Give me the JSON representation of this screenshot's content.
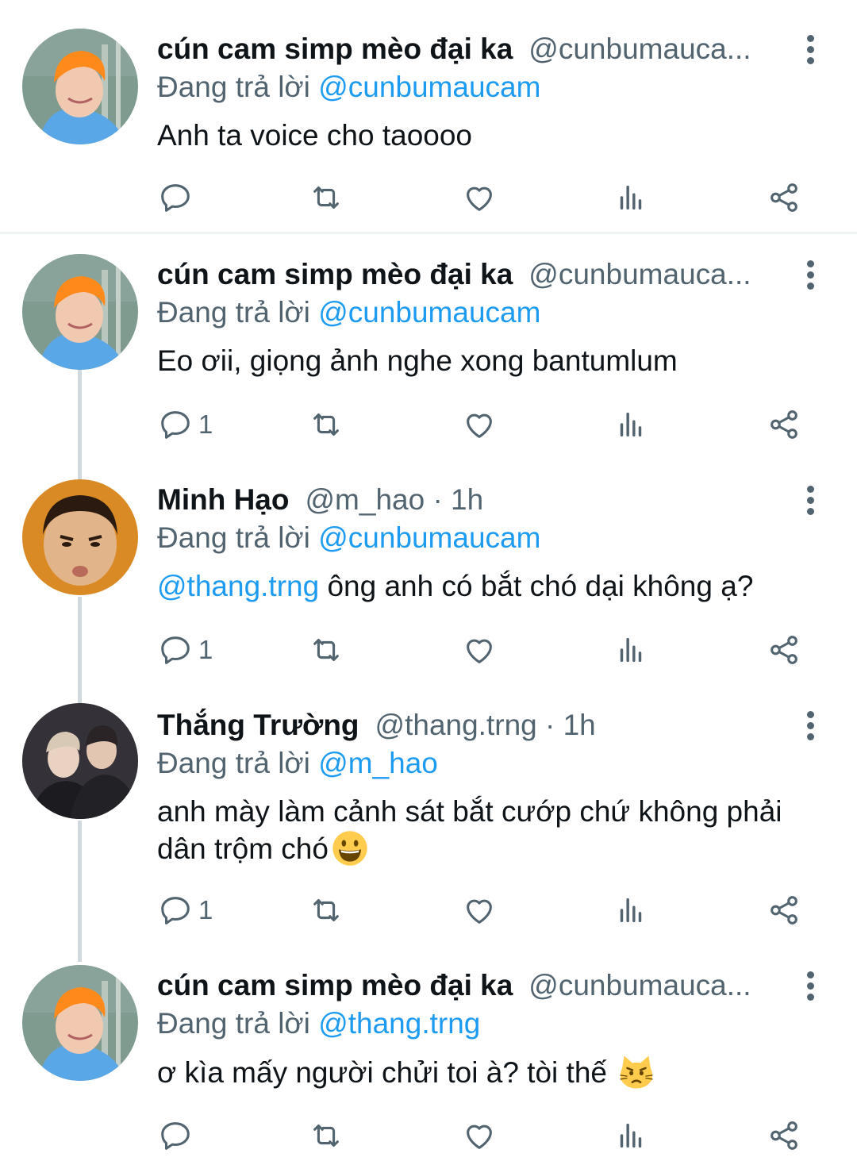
{
  "tweets": [
    {
      "name": "cún cam simp mèo đại ka",
      "handle": "@cunbumauca...",
      "reply_prefix": "Đang trả lời",
      "reply_to": "@cunbumaucam",
      "text": "Anh ta voice cho taoooo",
      "reply_count": "",
      "avatar": "orange-hair-avatar"
    },
    {
      "name": "cún cam simp mèo đại ka",
      "handle": "@cunbumauca...",
      "reply_prefix": "Đang trả lời",
      "reply_to": "@cunbumaucam",
      "text": "Eo ơii, giọng ảnh nghe xong bantumlum",
      "reply_count": "1",
      "avatar": "orange-hair-avatar"
    },
    {
      "name": "Minh Hạo",
      "handle": "@m_hao · 1h",
      "reply_prefix": "Đang trả lời",
      "reply_to": "@cunbumaucam",
      "text_mention": "@thang.trng",
      "text": " ông anh có bắt chó dại không ạ?",
      "reply_count": "1",
      "avatar": "child-face-avatar"
    },
    {
      "name": "Thắng Trường",
      "handle": "@thang.trng · 1h",
      "reply_prefix": "Đang trả lời",
      "reply_to": "@m_hao",
      "text": "anh mày làm cảnh sát bắt cướp chứ không phải dân trộm chó",
      "emoji": "grinning-face-emoji",
      "reply_count": "1",
      "avatar": "two-men-avatar"
    },
    {
      "name": "cún cam simp mèo đại ka",
      "handle": "@cunbumauca...",
      "reply_prefix": "Đang trả lời",
      "reply_to": "@thang.trng",
      "text": "ơ kìa mấy người chửi toi à? tòi thế",
      "emoji": "pouting-cat-emoji",
      "reply_count": "",
      "avatar": "orange-hair-avatar"
    }
  ],
  "icons": {
    "reply": "reply-icon",
    "retweet": "retweet-icon",
    "like": "heart-icon",
    "views": "views-icon",
    "share": "share-icon",
    "more": "more-vertical-icon"
  },
  "colors": {
    "link": "#1d9bf0",
    "secondary_text": "#536471",
    "thread_line": "#cfd9de"
  }
}
